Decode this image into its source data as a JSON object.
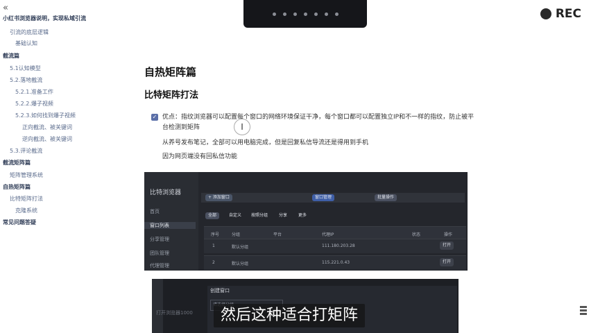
{
  "outline": {
    "collapse_icon": "«",
    "items": [
      {
        "label": "小红书浏览器说明，实现私域引流",
        "bold": true
      },
      {
        "label": "引流的底层逻辑",
        "bold": false
      },
      {
        "label": "基础认知",
        "bold": false
      },
      {
        "label": "截流篇",
        "bold": true
      },
      {
        "label": "5.1认知模型",
        "bold": false
      },
      {
        "label": "5.2.落地截流",
        "bold": false
      },
      {
        "label": "5.2.1.准备工作",
        "bold": false
      },
      {
        "label": "5.2.2.爆子视频",
        "bold": false
      },
      {
        "label": "5.2.3.如何找到爆子视频",
        "bold": false
      },
      {
        "label": "正向截流、被关键词",
        "bold": false
      },
      {
        "label": "逆向截流、被关键词",
        "bold": false
      },
      {
        "label": "5.3.评论截流",
        "bold": false
      },
      {
        "label": "截流矩阵篇",
        "bold": true
      },
      {
        "label": "矩阵管理系统",
        "bold": false
      },
      {
        "label": "自热矩阵篇",
        "bold": true
      },
      {
        "label": "比特矩阵打法",
        "bold": false
      },
      {
        "label": "克隆系统",
        "bold": false
      },
      {
        "label": "常见问题答疑",
        "bold": true
      }
    ]
  },
  "recorder": {
    "label": "REC"
  },
  "doc": {
    "h1": "自热矩阵篇",
    "h2": "比特矩阵打法",
    "task_text": "优点：指纹浏览器可以配置每个窗口的网络环境保证干净，每个窗口都可以配置独立IP和不一样的指纹，防止被平台检测到矩阵",
    "line2": "从养号发布笔记，全部可以用电脑完成，但是回复私信导流还是得用到手机",
    "line3": "因为网页端没有回私信功能"
  },
  "shot1": {
    "brand": "比特浏览器",
    "nav": [
      "首页",
      "窗口列表",
      "分享管理",
      "团队管理",
      "代理管理"
    ],
    "top_pills": [
      "+ 添加窗口",
      "窗口管理",
      "批量操作"
    ],
    "tabs": [
      "全部",
      "自定义",
      "按照分组",
      "分享",
      "更多"
    ],
    "columns": [
      "序号",
      "分组",
      "平台",
      "代理IP",
      "状态",
      "操作"
    ],
    "rows": [
      {
        "id": "1",
        "group": "默认分组",
        "ip": "111.180.203.28",
        "status": "打开"
      },
      {
        "id": "2",
        "group": "默认分组",
        "ip": "115.221.0.43",
        "status": "打开"
      }
    ]
  },
  "shot2": {
    "dialog_title": "创建窗口",
    "field": "请选择分组",
    "ghost": "打开浏览器1000"
  },
  "caption": "然后这种适合打矩阵"
}
